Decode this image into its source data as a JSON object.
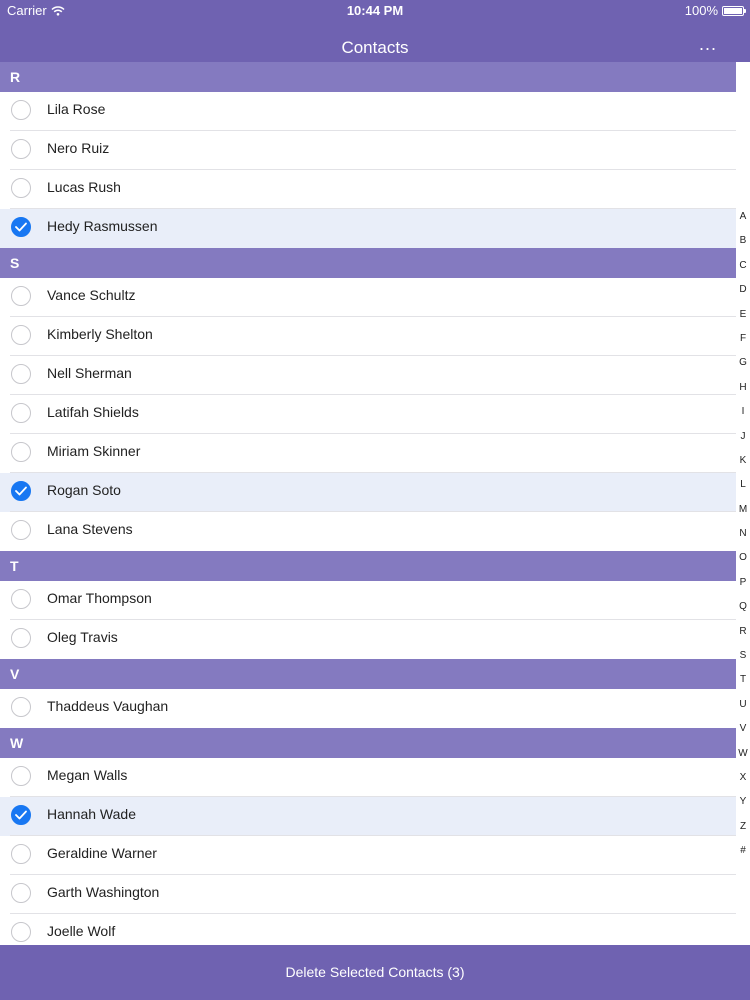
{
  "status_bar": {
    "carrier": "Carrier",
    "time": "10:44 PM",
    "battery": "100%"
  },
  "nav": {
    "title": "Contacts",
    "more": "..."
  },
  "sections": [
    {
      "letter": "R",
      "contacts": [
        {
          "name": "Lila Rose",
          "selected": false
        },
        {
          "name": "Nero Ruiz",
          "selected": false
        },
        {
          "name": "Lucas Rush",
          "selected": false
        },
        {
          "name": "Hedy Rasmussen",
          "selected": true
        }
      ]
    },
    {
      "letter": "S",
      "contacts": [
        {
          "name": "Vance Schultz",
          "selected": false
        },
        {
          "name": "Kimberly Shelton",
          "selected": false
        },
        {
          "name": "Nell Sherman",
          "selected": false
        },
        {
          "name": "Latifah Shields",
          "selected": false
        },
        {
          "name": "Miriam Skinner",
          "selected": false
        },
        {
          "name": "Rogan Soto",
          "selected": true
        },
        {
          "name": "Lana Stevens",
          "selected": false
        }
      ]
    },
    {
      "letter": "T",
      "contacts": [
        {
          "name": "Omar Thompson",
          "selected": false
        },
        {
          "name": "Oleg Travis",
          "selected": false
        }
      ]
    },
    {
      "letter": "V",
      "contacts": [
        {
          "name": "Thaddeus Vaughan",
          "selected": false
        }
      ]
    },
    {
      "letter": "W",
      "contacts": [
        {
          "name": "Megan Walls",
          "selected": false
        },
        {
          "name": "Hannah Wade",
          "selected": true
        },
        {
          "name": "Geraldine Warner",
          "selected": false
        },
        {
          "name": "Garth Washington",
          "selected": false
        },
        {
          "name": "Joelle Wolf",
          "selected": false
        }
      ]
    }
  ],
  "index_letters": [
    "A",
    "B",
    "C",
    "D",
    "E",
    "F",
    "G",
    "H",
    "I",
    "J",
    "K",
    "L",
    "M",
    "N",
    "O",
    "P",
    "Q",
    "R",
    "S",
    "T",
    "U",
    "V",
    "W",
    "X",
    "Y",
    "Z",
    "#"
  ],
  "bottom_action": "Delete Selected Contacts (3)",
  "colors": {
    "bar": "#6f62b1",
    "section": "#847ac0",
    "check": "#1877f2",
    "selected_row": "#e9eef9"
  }
}
